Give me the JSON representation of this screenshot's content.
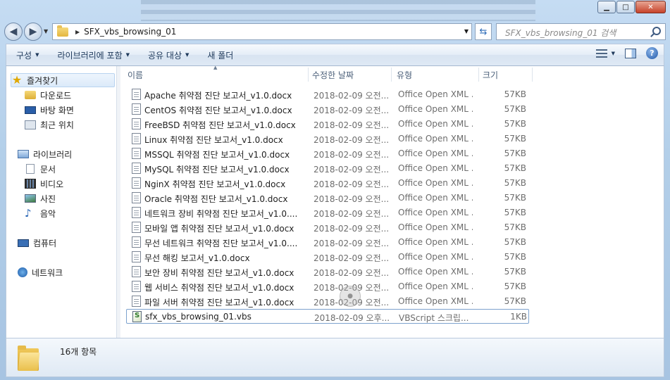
{
  "window": {
    "caption_minimize": "▁",
    "caption_maximize": "□",
    "caption_close": "✕"
  },
  "address": {
    "path": "SFX_vbs_browsing_01",
    "search_placeholder": "SFX_vbs_browsing_01 검색"
  },
  "toolbar": {
    "organize": "구성",
    "include_library": "라이브러리에 포함",
    "share_with": "공유 대상",
    "new_folder": "새 폴더"
  },
  "nav": {
    "favorites": "즐겨찾기",
    "downloads": "다운로드",
    "desktop": "바탕 화면",
    "recent": "최근 위치",
    "libraries": "라이브러리",
    "documents": "문서",
    "videos": "비디오",
    "pictures": "사진",
    "music": "음악",
    "computer": "컴퓨터",
    "network": "네트워크"
  },
  "columns": {
    "name": "이름",
    "date": "수정한 날짜",
    "type": "유형",
    "size": "크기"
  },
  "files": [
    {
      "name": "Apache 취약점 진단 보고서_v1.0.docx",
      "date": "2018-02-09 오전...",
      "type": "Office Open XML ...",
      "size": "57KB",
      "icon": "docx-icon"
    },
    {
      "name": "CentOS 취약점 진단 보고서_v1.0.docx",
      "date": "2018-02-09 오전...",
      "type": "Office Open XML ...",
      "size": "57KB",
      "icon": "docx-icon"
    },
    {
      "name": "FreeBSD 취약점 진단 보고서_v1.0.docx",
      "date": "2018-02-09 오전...",
      "type": "Office Open XML ...",
      "size": "57KB",
      "icon": "docx-icon"
    },
    {
      "name": "Linux 취약점 진단 보고서_v1.0.docx",
      "date": "2018-02-09 오전...",
      "type": "Office Open XML ...",
      "size": "57KB",
      "icon": "docx-icon"
    },
    {
      "name": "MSSQL 취약점 진단 보고서_v1.0.docx",
      "date": "2018-02-09 오전...",
      "type": "Office Open XML ...",
      "size": "57KB",
      "icon": "docx-icon"
    },
    {
      "name": "MySQL 취약점 진단 보고서_v1.0.docx",
      "date": "2018-02-09 오전...",
      "type": "Office Open XML ...",
      "size": "57KB",
      "icon": "docx-icon"
    },
    {
      "name": "NginX 취약점 진단 보고서_v1.0.docx",
      "date": "2018-02-09 오전...",
      "type": "Office Open XML ...",
      "size": "57KB",
      "icon": "docx-icon"
    },
    {
      "name": "Oracle 취약점 진단 보고서_v1.0.docx",
      "date": "2018-02-09 오전...",
      "type": "Office Open XML ...",
      "size": "57KB",
      "icon": "docx-icon"
    },
    {
      "name": "네트워크 장비 취약점 진단 보고서_v1.0....",
      "date": "2018-02-09 오전...",
      "type": "Office Open XML ...",
      "size": "57KB",
      "icon": "docx-icon"
    },
    {
      "name": "모바일 앱 취약점 진단 보고서_v1.0.docx",
      "date": "2018-02-09 오전...",
      "type": "Office Open XML ...",
      "size": "57KB",
      "icon": "docx-icon"
    },
    {
      "name": "무선 네트워크 취약점 진단 보고서_v1.0....",
      "date": "2018-02-09 오전...",
      "type": "Office Open XML ...",
      "size": "57KB",
      "icon": "docx-icon"
    },
    {
      "name": "무선 해킹 보고서_v1.0.docx",
      "date": "2018-02-09 오전...",
      "type": "Office Open XML ...",
      "size": "57KB",
      "icon": "docx-icon"
    },
    {
      "name": "보안 장비 취약점 진단 보고서_v1.0.docx",
      "date": "2018-02-09 오전...",
      "type": "Office Open XML ...",
      "size": "57KB",
      "icon": "docx-icon"
    },
    {
      "name": "웹 서비스 취약점 진단 보고서_v1.0.docx",
      "date": "2018-02-09 오전...",
      "type": "Office Open XML ...",
      "size": "57KB",
      "icon": "docx-icon"
    },
    {
      "name": "파일 서버 취약점 진단 보고서_v1.0.docx",
      "date": "2018-02-09 오전...",
      "type": "Office Open XML ...",
      "size": "57KB",
      "icon": "docx-icon"
    },
    {
      "name": "sfx_vbs_browsing_01.vbs",
      "date": "2018-02-09 오후...",
      "type": "VBScript 스크립...",
      "size": "1KB",
      "icon": "vbs-script-icon"
    }
  ],
  "details": {
    "item_count": "16개 항목"
  },
  "colors": {
    "frame": "#b3cfe9",
    "toolbar": "#e4edf7",
    "selection_border": "#7da2ce",
    "close_button": "#c7432a"
  }
}
